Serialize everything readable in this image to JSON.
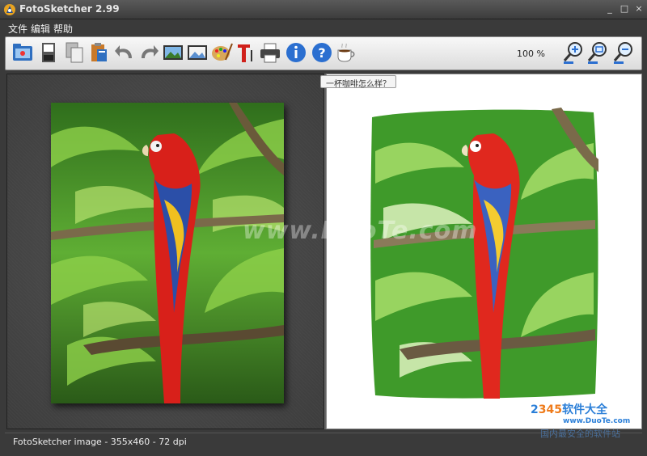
{
  "window": {
    "title": "FotoSketcher 2.99",
    "controls": [
      "_",
      "□",
      "×"
    ]
  },
  "menu": [
    {
      "label": "文件"
    },
    {
      "label": "编辑"
    },
    {
      "label": "帮助"
    }
  ],
  "toolbar": {
    "buttons": [
      {
        "name": "open-image-icon"
      },
      {
        "name": "save-icon"
      },
      {
        "name": "copy-icon"
      },
      {
        "name": "paste-icon"
      },
      {
        "name": "undo-icon"
      },
      {
        "name": "redo-icon"
      },
      {
        "name": "original-image-icon"
      },
      {
        "name": "result-image-icon"
      },
      {
        "name": "palette-icon"
      },
      {
        "name": "text-icon"
      },
      {
        "name": "print-icon"
      },
      {
        "name": "info-icon"
      },
      {
        "name": "help-icon"
      },
      {
        "name": "coffee-icon"
      }
    ],
    "zoom_label": "100 %",
    "zoom_buttons": [
      {
        "name": "zoom-in-icon"
      },
      {
        "name": "zoom-fit-icon"
      },
      {
        "name": "zoom-out-icon"
      }
    ]
  },
  "tooltip": "一杯咖啡怎么样？",
  "status": {
    "text": "FotoSketcher image - 355x460 - 72 dpi"
  },
  "watermark": "www.DuoTe.com",
  "brand": {
    "logo_prefix": "2",
    "logo_mid": "345",
    "logo_suffix": "软件大全",
    "url": "www.DuoTe.com",
    "slogan": "国内最安全的软件站"
  },
  "colors": {
    "accent_blue": "#2b7fd8",
    "parrot_red": "#d8201a",
    "foliage_green": "#3f9a2a"
  }
}
